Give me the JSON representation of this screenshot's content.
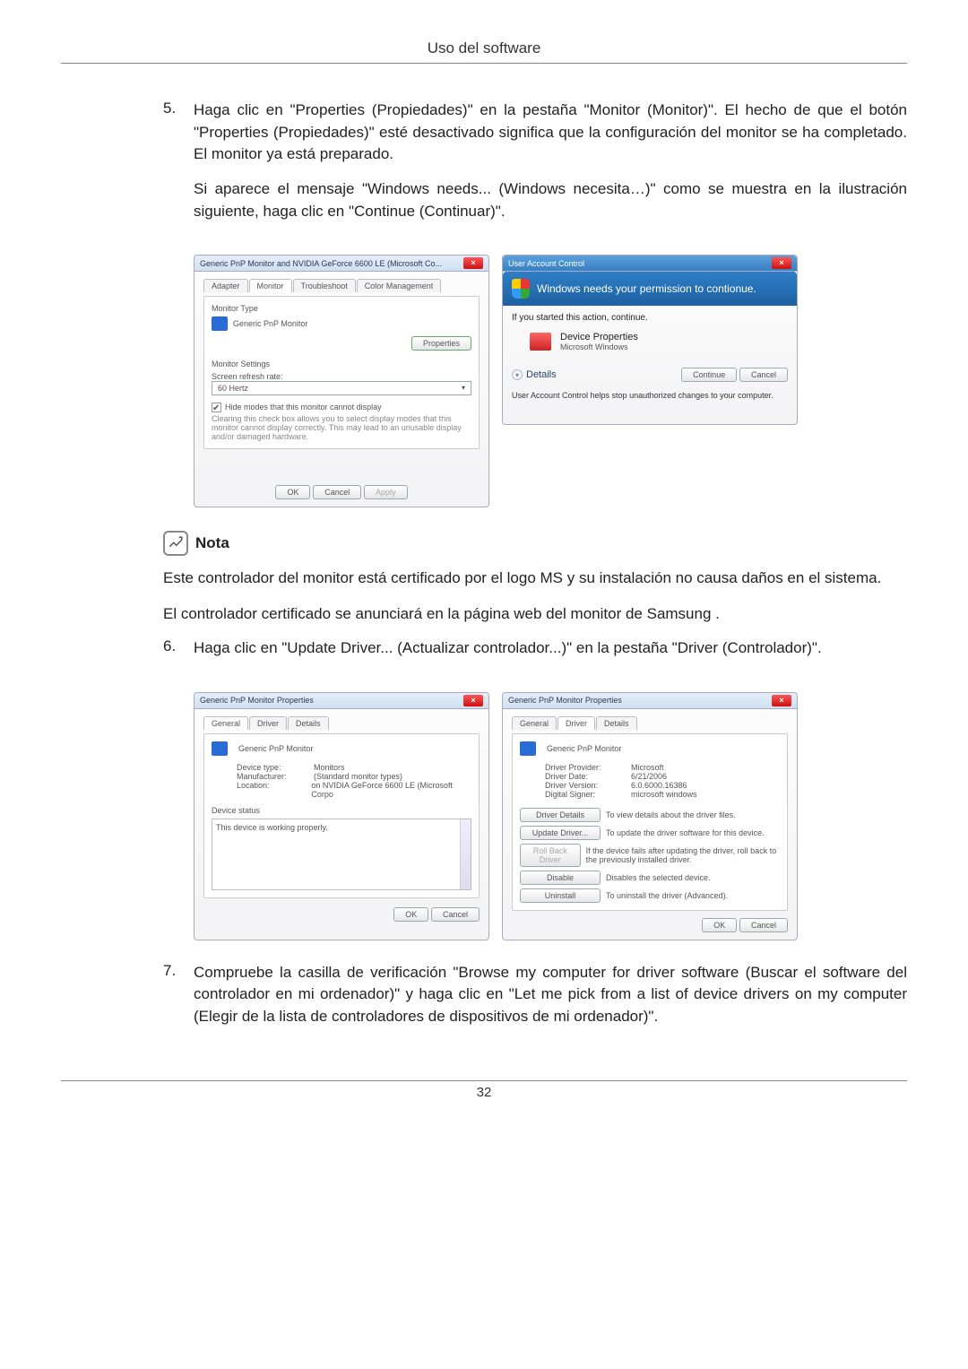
{
  "header_title": "Uso del software",
  "page_number": "32",
  "steps": {
    "s5": {
      "num": "5.",
      "p1": "Haga clic en \"Properties (Propiedades)\" en la pestaña \"Monitor (Monitor)\". El hecho de que el botón \"Properties (Propiedades)\" esté desactivado significa que la configuración del monitor se ha completado. El monitor ya está preparado.",
      "p2": "Si aparece el mensaje \"Windows needs... (Windows necesita…)\" como se muestra en la ilustración siguiente, haga clic en \"Continue (Continuar)\"."
    },
    "s6": {
      "num": "6.",
      "p1": "Haga clic en \"Update Driver... (Actualizar controlador...)\" en la pestaña \"Driver (Controlador)\"."
    },
    "s7": {
      "num": "7.",
      "p1": "Compruebe la casilla de verificación \"Browse my computer for driver software (Buscar el software del controlador en mi ordenador)\" y haga clic en \"Let me pick from a list of device drivers on my computer (Elegir de la lista de controladores de dispositivos de mi ordenador)\"."
    }
  },
  "note": {
    "label": "Nota",
    "p1": "Este controlador del monitor está certificado por el logo MS y su instalación no causa daños en el sistema.",
    "p2": "El controlador certificado se anunciará en la página web del monitor de Samsung ."
  },
  "dlg1": {
    "title": "Generic PnP Monitor and NVIDIA GeForce 6600 LE (Microsoft Co...",
    "tabs": {
      "adapter": "Adapter",
      "monitor": "Monitor",
      "troubleshoot": "Troubleshoot",
      "color": "Color Management"
    },
    "section_type": "Monitor Type",
    "type_name": "Generic PnP Monitor",
    "btn_properties": "Properties",
    "section_settings": "Monitor Settings",
    "refresh_label": "Screen refresh rate:",
    "refresh_value": "60 Hertz",
    "hide_check": "Hide modes that this monitor cannot display",
    "hide_desc": "Clearing this check box allows you to select display modes that this monitor cannot display correctly. This may lead to an unusable display and/or damaged hardware.",
    "ok": "OK",
    "cancel": "Cancel",
    "apply": "Apply"
  },
  "dlg2": {
    "title": "User Account Control",
    "headline": "Windows needs your permission to contionue.",
    "started": "If you started this action, continue.",
    "prop": "Device Properties",
    "pub": "Microsoft Windows",
    "details": "Details",
    "continue": "Continue",
    "cancel": "Cancel",
    "footer": "User Account Control helps stop unauthorized changes to your computer."
  },
  "dlg3": {
    "title": "Generic PnP Monitor Properties",
    "tabs": {
      "general": "General",
      "driver": "Driver",
      "details": "Details"
    },
    "name": "Generic PnP Monitor",
    "devtype_l": "Device type:",
    "devtype_v": "Monitors",
    "manu_l": "Manufacturer:",
    "manu_v": "(Standard monitor types)",
    "loc_l": "Location:",
    "loc_v": "on NVIDIA GeForce 6600 LE (Microsoft Corpo",
    "status_section": "Device status",
    "status_text": "This device is working properly.",
    "ok": "OK",
    "cancel": "Cancel"
  },
  "dlg4": {
    "title": "Generic PnP Monitor Properties",
    "tabs": {
      "general": "General",
      "driver": "Driver",
      "details": "Details"
    },
    "name": "Generic PnP Monitor",
    "prov_l": "Driver Provider:",
    "prov_v": "Microsoft",
    "date_l": "Driver Date:",
    "date_v": "6/21/2006",
    "ver_l": "Driver Version:",
    "ver_v": "6.0.6000.16386",
    "sig_l": "Digital Signer:",
    "sig_v": "microsoft windows",
    "b_details": "Driver Details",
    "b_details_d": "To view details about the driver files.",
    "b_update": "Update Driver...",
    "b_update_d": "To update the driver software for this device.",
    "b_roll": "Roll Back Driver",
    "b_roll_d": "If the device fails after updating the driver, roll back to the previously installed driver.",
    "b_disable": "Disable",
    "b_disable_d": "Disables the selected device.",
    "b_uninstall": "Uninstall",
    "b_uninstall_d": "To uninstall the driver (Advanced).",
    "ok": "OK",
    "cancel": "Cancel"
  }
}
